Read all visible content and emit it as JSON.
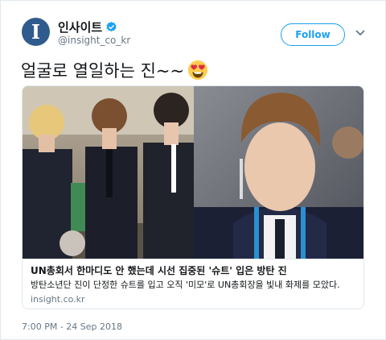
{
  "author": {
    "display_name": "인사이트",
    "handle": "@insight_co_kr",
    "avatar_letter": "I",
    "avatar_color": "#2f5c8c",
    "verified": true
  },
  "follow_button": {
    "label": "Follow",
    "color": "#1da1f2"
  },
  "tweet": {
    "text": "얼굴로 열일하는 진~~",
    "emoji": "smiling-face-with-heart-eyes-icon"
  },
  "card": {
    "image": "link-preview-photo",
    "title": "UN총회서 한마디도 안 했는데 시선 집중된 '슈트' 입은 방탄 진",
    "description": "방탄소년단 진이 단정한 슈트를 입고 오직 '미모'로 UN총회장을 빛내 화제를 모았다.",
    "domain": "insight.co.kr"
  },
  "timestamp": "7:00 PM - 24 Sep 2018"
}
